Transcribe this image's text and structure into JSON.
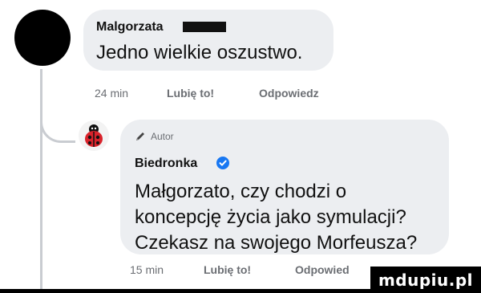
{
  "comment_1": {
    "author": "Malgorzata",
    "text": "Jedno wielkie oszustwo.",
    "time": "24 min",
    "like_label": "Lubię to!",
    "reply_label": "Odpowiedz"
  },
  "comment_2": {
    "badge": "Autor",
    "author": "Biedronka",
    "text_lines": [
      "Małgorzato, czy chodzi o",
      "koncepcję życia jako symulacji?",
      "Czekasz na swojego Morfeusza?"
    ],
    "time": "15 min",
    "like_label": "Lubię to!",
    "reply_label": "Odpowied"
  },
  "watermark": "mdupiu.pl",
  "icons": {
    "verified": "verified-badge-icon",
    "author_badge": "author-pen-icon",
    "avatar": "ladybug-avatar-icon"
  },
  "colors": {
    "bubble": "#eceef1",
    "verified": "#1877f2",
    "ladybug_red": "#d9232b"
  }
}
